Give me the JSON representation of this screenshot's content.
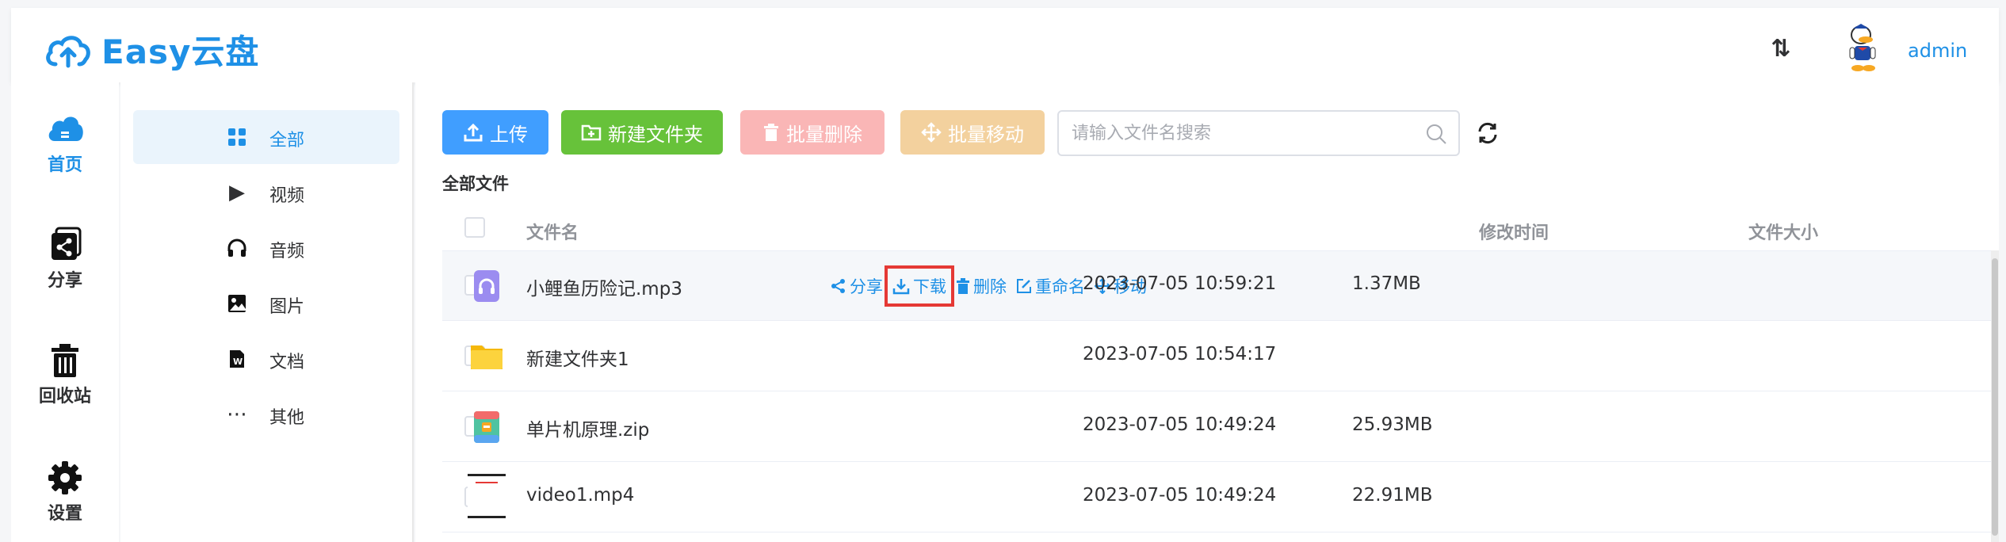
{
  "app": {
    "title": "Easy云盘",
    "user": "admin",
    "accent": "#1e90e6"
  },
  "nav": [
    {
      "label": "首页",
      "icon": "cloud-home-icon"
    },
    {
      "label": "分享",
      "icon": "share-icon"
    },
    {
      "label": "回收站",
      "icon": "trash-icon"
    },
    {
      "label": "设置",
      "icon": "gear-icon"
    }
  ],
  "categories": [
    {
      "label": "全部",
      "icon": "grid-icon",
      "active": true
    },
    {
      "label": "视频",
      "icon": "play-icon"
    },
    {
      "label": "音频",
      "icon": "headphones-icon"
    },
    {
      "label": "图片",
      "icon": "image-icon"
    },
    {
      "label": "文档",
      "icon": "doc-icon"
    },
    {
      "label": "其他",
      "icon": "more-icon"
    }
  ],
  "toolbar": {
    "upload": "上传",
    "new_folder": "新建文件夹",
    "batch_delete": "批量删除",
    "batch_move": "批量移动",
    "search_placeholder": "请输入文件名搜索",
    "colors": {
      "upload": "#409eff",
      "new_folder": "#67c23a",
      "batch_delete": "#fab6b6",
      "batch_move": "#f3d19e"
    }
  },
  "breadcrumb": "全部文件",
  "table": {
    "headers": {
      "name": "文件名",
      "time": "修改时间",
      "size": "文件大小"
    },
    "actions": [
      "分享",
      "下载",
      "删除",
      "重命名",
      "移动"
    ],
    "rows": [
      {
        "name": "小鲤鱼历险记.mp3",
        "time": "2023-07-05 10:59:21",
        "size": "1.37MB",
        "type": "audio"
      },
      {
        "name": "新建文件夹1",
        "time": "2023-07-05 10:54:17",
        "size": "",
        "type": "folder"
      },
      {
        "name": "单片机原理.zip",
        "time": "2023-07-05 10:49:24",
        "size": "25.93MB",
        "type": "zip"
      },
      {
        "name": "video1.mp4",
        "time": "2023-07-05 10:49:24",
        "size": "22.91MB",
        "type": "video"
      }
    ]
  }
}
